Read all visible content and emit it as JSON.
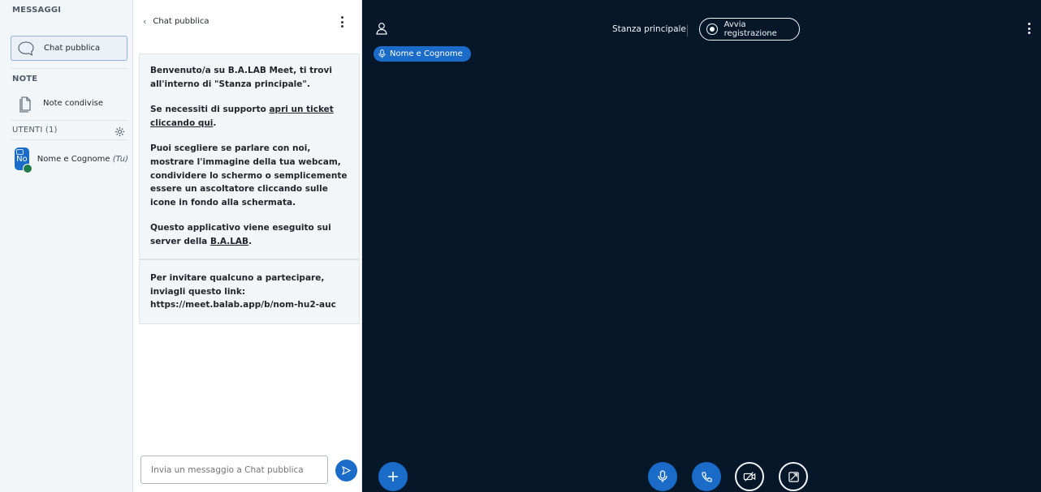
{
  "sidebar": {
    "messages_title": "MESSAGGI",
    "public_chat_label": "Chat pubblica",
    "notes_title": "NOTE",
    "shared_notes_label": "Note condivise",
    "users_title": "UTENTI (1)",
    "user": {
      "initials": "No",
      "name": "Nome e Cognome",
      "you_label": "(Tu)"
    }
  },
  "chat": {
    "title": "Chat pubblica",
    "welcome": {
      "l1_a": "Benvenuto/a su B.A.LAB Meet, ti trovi all'interno di ",
      "l1_room": "\"Stanza principale\"",
      "l1_b": ".",
      "l2_a": "Se necessiti di supporto ",
      "l2_link": "apri un ticket cliccando qui",
      "l2_b": ".",
      "l3": "Puoi scegliere se parlare con noi, mostrare l'immagine della tua webcam, condividere lo schermo o semplicemente essere un ascoltatore cliccando sulle icone in fondo alla schermata.",
      "l4_a": "Questo applicativo viene eseguito sui server della ",
      "l4_link": "B.A.LAB",
      "l4_b": "."
    },
    "invite": "Per invitare qualcuno a partecipare, inviagli questo link: https://meet.balab.app/b/nom-hu2-auc",
    "composer_placeholder": "Invia un messaggio a Chat pubblica"
  },
  "main": {
    "room_name": "Stanza principale",
    "record_label": "Avvia registrazione",
    "talker_name": "Nome e Cognome"
  },
  "colors": {
    "accent": "#1a6cc8",
    "stage_bg": "#06172a",
    "panel_bg": "#f3f6f9",
    "presence": "#1e7d4a"
  },
  "icons": [
    "chat-bubble-icon",
    "document-icon",
    "gear-icon",
    "user-icon",
    "microphone-icon",
    "phone-icon",
    "video-off-icon",
    "screen-share-off-icon",
    "plus-icon",
    "send-icon"
  ]
}
